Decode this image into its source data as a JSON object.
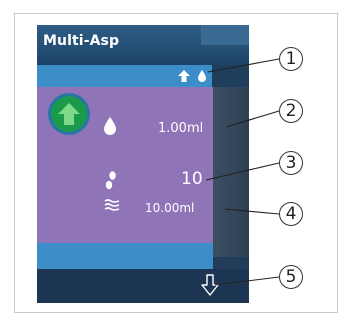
{
  "screen": {
    "title": "Multi-Asp",
    "volume_value": "1.00ml",
    "count_value": "10",
    "total_value": "10.00ml"
  },
  "icons": {
    "header_arrow": "arrow-up-icon",
    "header_drop": "droplet-icon",
    "main_arrow": "arrow-up-icon",
    "volume": "droplet-icon",
    "count": "footsteps-icon",
    "total": "waves-icon",
    "bottom": "arrow-down-icon"
  },
  "callouts": [
    "1",
    "2",
    "3",
    "4",
    "5"
  ],
  "colors": {
    "screen_bg": "#1e3f5c",
    "accent_blue": "#3d8ec8",
    "card_purple": "#8f74b8",
    "go_green": "#1b9a4b"
  }
}
